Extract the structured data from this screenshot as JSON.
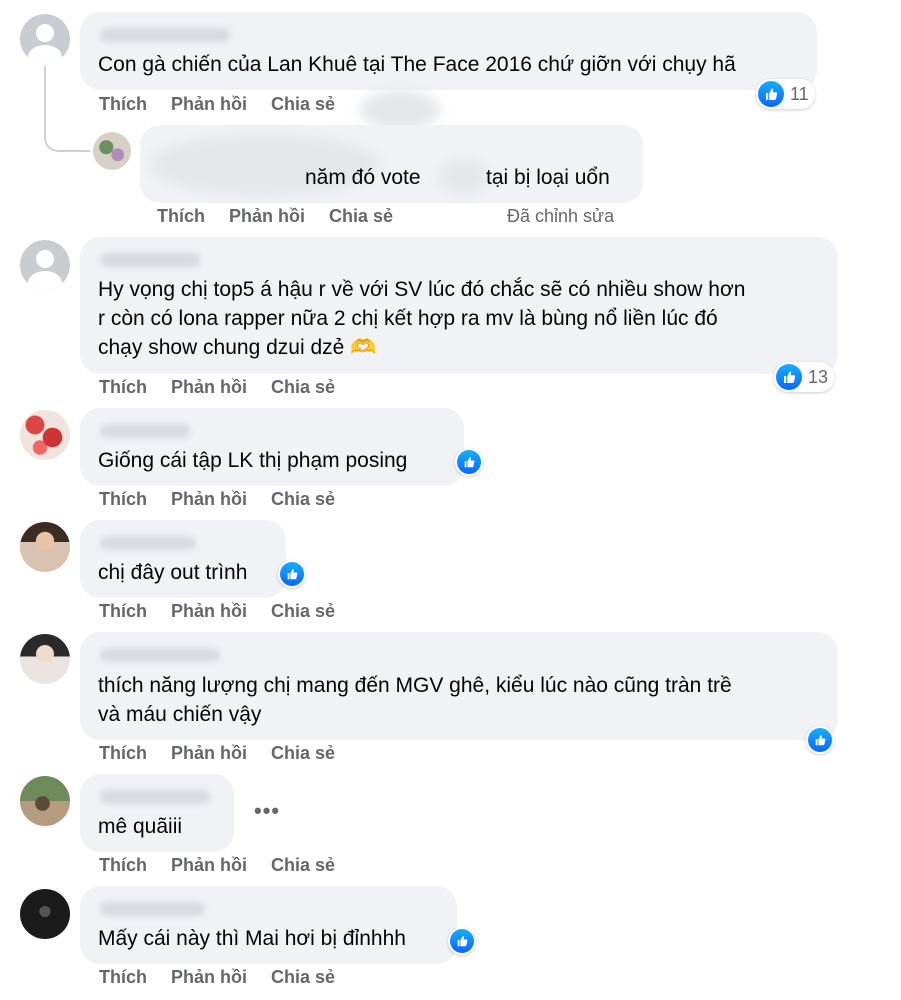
{
  "actions": {
    "like": "Thích",
    "reply": "Phản hồi",
    "share": "Chia sẻ",
    "edited": "Đã chỉnh sửa"
  },
  "comments": [
    {
      "text": "Con gà chiến của Lan Khuê tại The Face 2016 chứ giỡn với chụy hã",
      "likes": "11"
    },
    {
      "text": "năm đó vote",
      "text_after": "tại bị loại uổn"
    },
    {
      "lines": [
        "Hy vọng chị top5 á hậu r về với SV lúc đó chắc sẽ có nhiều show hơn",
        "r còn có lona rapper nữa 2 chị kết hợp ra mv là bùng nổ liền lúc đó",
        "chạy show chung dzui dzẻ 🫶"
      ],
      "likes": "13"
    },
    {
      "text": "Giống cái tập LK thị phạm posing"
    },
    {
      "text": "chị đây out trình"
    },
    {
      "lines": [
        "thích năng lượng chị mang đến MGV ghê, kiểu lúc nào cũng tràn trề",
        "và máu chiến vậy"
      ]
    },
    {
      "text": "mê quãiii"
    },
    {
      "text": "Mấy cái này thì Mai hơi bị đỉnhhh"
    }
  ],
  "icons": {
    "like": "thumbs-up-icon",
    "more": "more-dots-icon",
    "avatar_default": "default-avatar-icon"
  },
  "colors": {
    "like_blue": "#0866ff",
    "bubble": "#f0f2f5",
    "secondary_text": "#65676b"
  }
}
